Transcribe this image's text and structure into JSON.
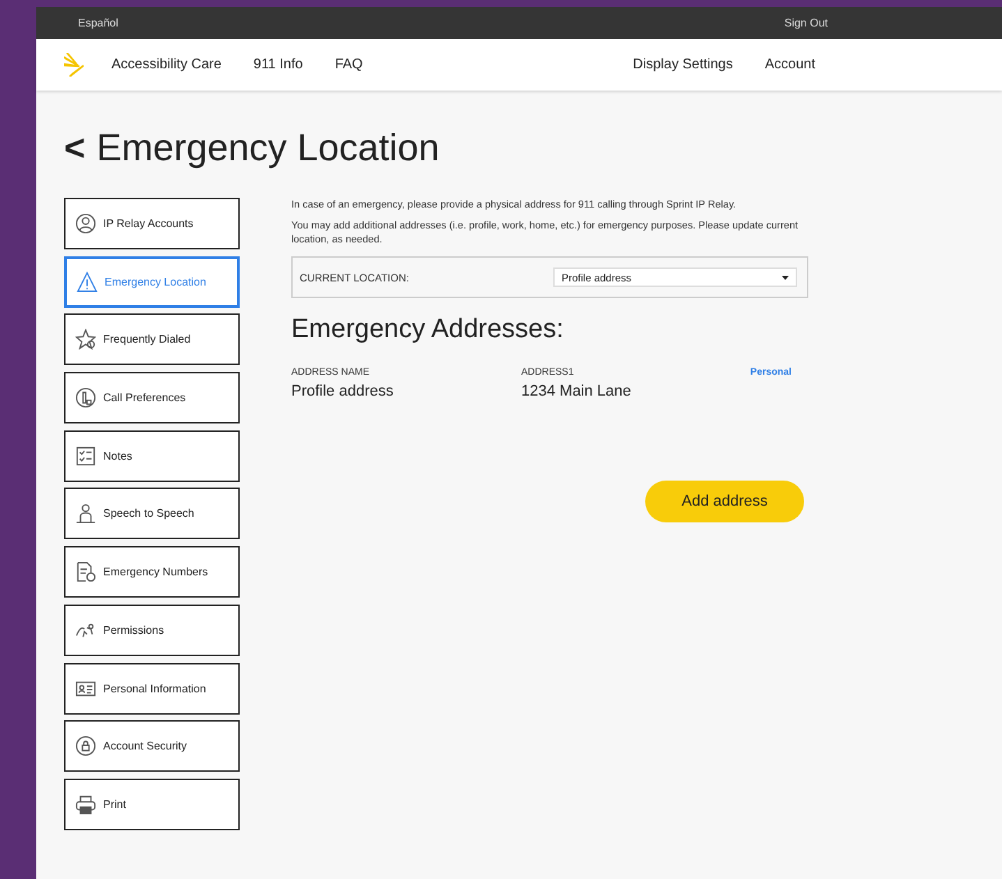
{
  "top_bar": {
    "language_link": "Español",
    "sign_out": "Sign Out"
  },
  "nav": {
    "left": [
      "Accessibility Care",
      "911 Info",
      "FAQ"
    ],
    "right": [
      "Display Settings",
      "Account"
    ]
  },
  "page_title": {
    "back": "<",
    "text": "Emergency Location"
  },
  "sidebar": {
    "items": [
      {
        "label": "IP Relay Accounts",
        "selected": false
      },
      {
        "label": "Emergency Location",
        "selected": true
      },
      {
        "label": "Frequently Dialed",
        "selected": false
      },
      {
        "label": "Call Preferences",
        "selected": false
      },
      {
        "label": "Notes",
        "selected": false
      },
      {
        "label": "Speech to Speech",
        "selected": false
      },
      {
        "label": "Emergency Numbers",
        "selected": false
      },
      {
        "label": "Permissions",
        "selected": false
      },
      {
        "label": "Personal Information",
        "selected": false
      },
      {
        "label": "Account Security",
        "selected": false
      },
      {
        "label": "Print",
        "selected": false
      }
    ]
  },
  "intro": [
    "In case of an emergency, please provide a physical address for 911 calling through Sprint IP Relay.",
    "You may add additional addresses (i.e. profile, work, home, etc.) for emergency purposes. Please update current location, as needed."
  ],
  "current_location": {
    "label": "CURRENT LOCATION:",
    "value": "Profile address"
  },
  "addresses": {
    "title": "Emergency Addresses:",
    "columns": [
      "ADDRESS NAME",
      "ADDRESS1"
    ],
    "rows": [
      {
        "name": "Profile address",
        "address1": "1234 Main Lane",
        "tag": "Personal"
      }
    ]
  },
  "add_button": "Add address"
}
